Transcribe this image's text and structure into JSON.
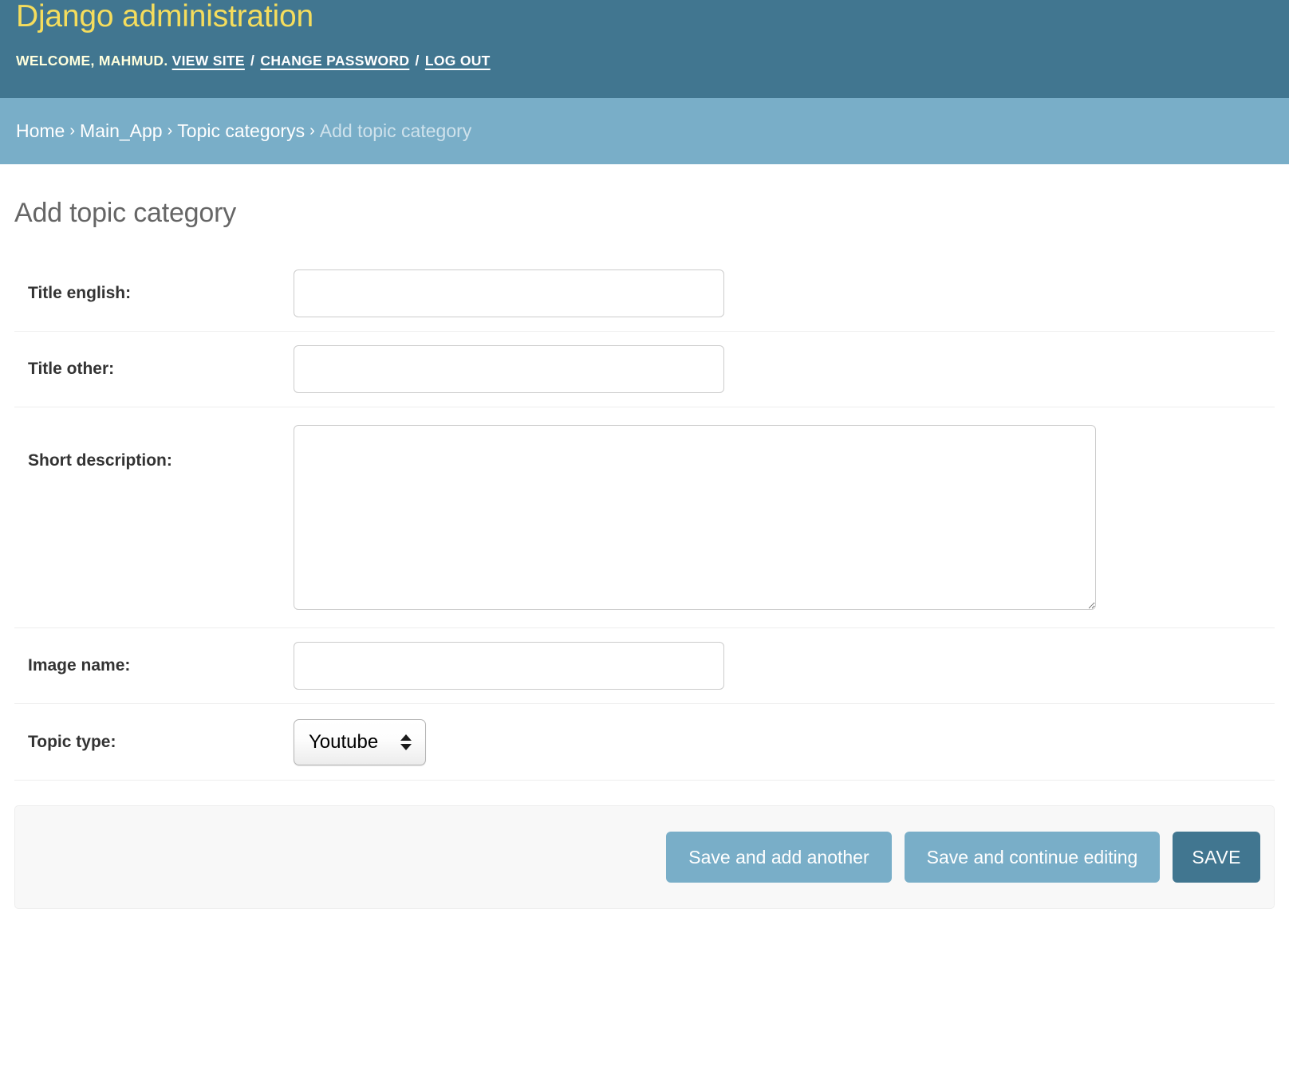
{
  "header": {
    "site_name": "Django administration",
    "welcome_prefix": "WELCOME,",
    "username": "MAHMUD.",
    "links": [
      {
        "label": "VIEW SITE",
        "name": "view-site-link"
      },
      {
        "label": "CHANGE PASSWORD",
        "name": "change-password-link"
      },
      {
        "label": "LOG OUT",
        "name": "log-out-link"
      }
    ],
    "separator": "/",
    "bg_color": "#417690",
    "title_color": "#f5dd5d"
  },
  "breadcrumbs": {
    "bg_color": "#79aec8",
    "separator": "›",
    "items": [
      {
        "label": "Home",
        "current": false
      },
      {
        "label": "Main_App",
        "current": false
      },
      {
        "label": "Topic categorys",
        "current": false
      },
      {
        "label": "Add topic category",
        "current": true
      }
    ]
  },
  "page": {
    "title": "Add topic category"
  },
  "form": {
    "rows": [
      {
        "label": "Title english:",
        "type": "text",
        "value": "",
        "placeholder": "",
        "name": "title-english"
      },
      {
        "label": "Title other:",
        "type": "text",
        "value": "",
        "placeholder": "",
        "name": "title-other"
      },
      {
        "label": "Short description:",
        "type": "textarea",
        "value": "",
        "placeholder": "",
        "name": "short-description"
      },
      {
        "label": "Image name:",
        "type": "text",
        "value": "",
        "placeholder": "",
        "name": "image-name"
      },
      {
        "label": "Topic type:",
        "type": "select",
        "value": "Youtube",
        "options": [
          "Youtube"
        ],
        "name": "topic-type"
      }
    ]
  },
  "submit_row": {
    "save_and_add_another": "Save and add another",
    "save_and_continue": "Save and continue editing",
    "save": "SAVE",
    "button_color": "#79aec8",
    "primary_color": "#417690"
  }
}
